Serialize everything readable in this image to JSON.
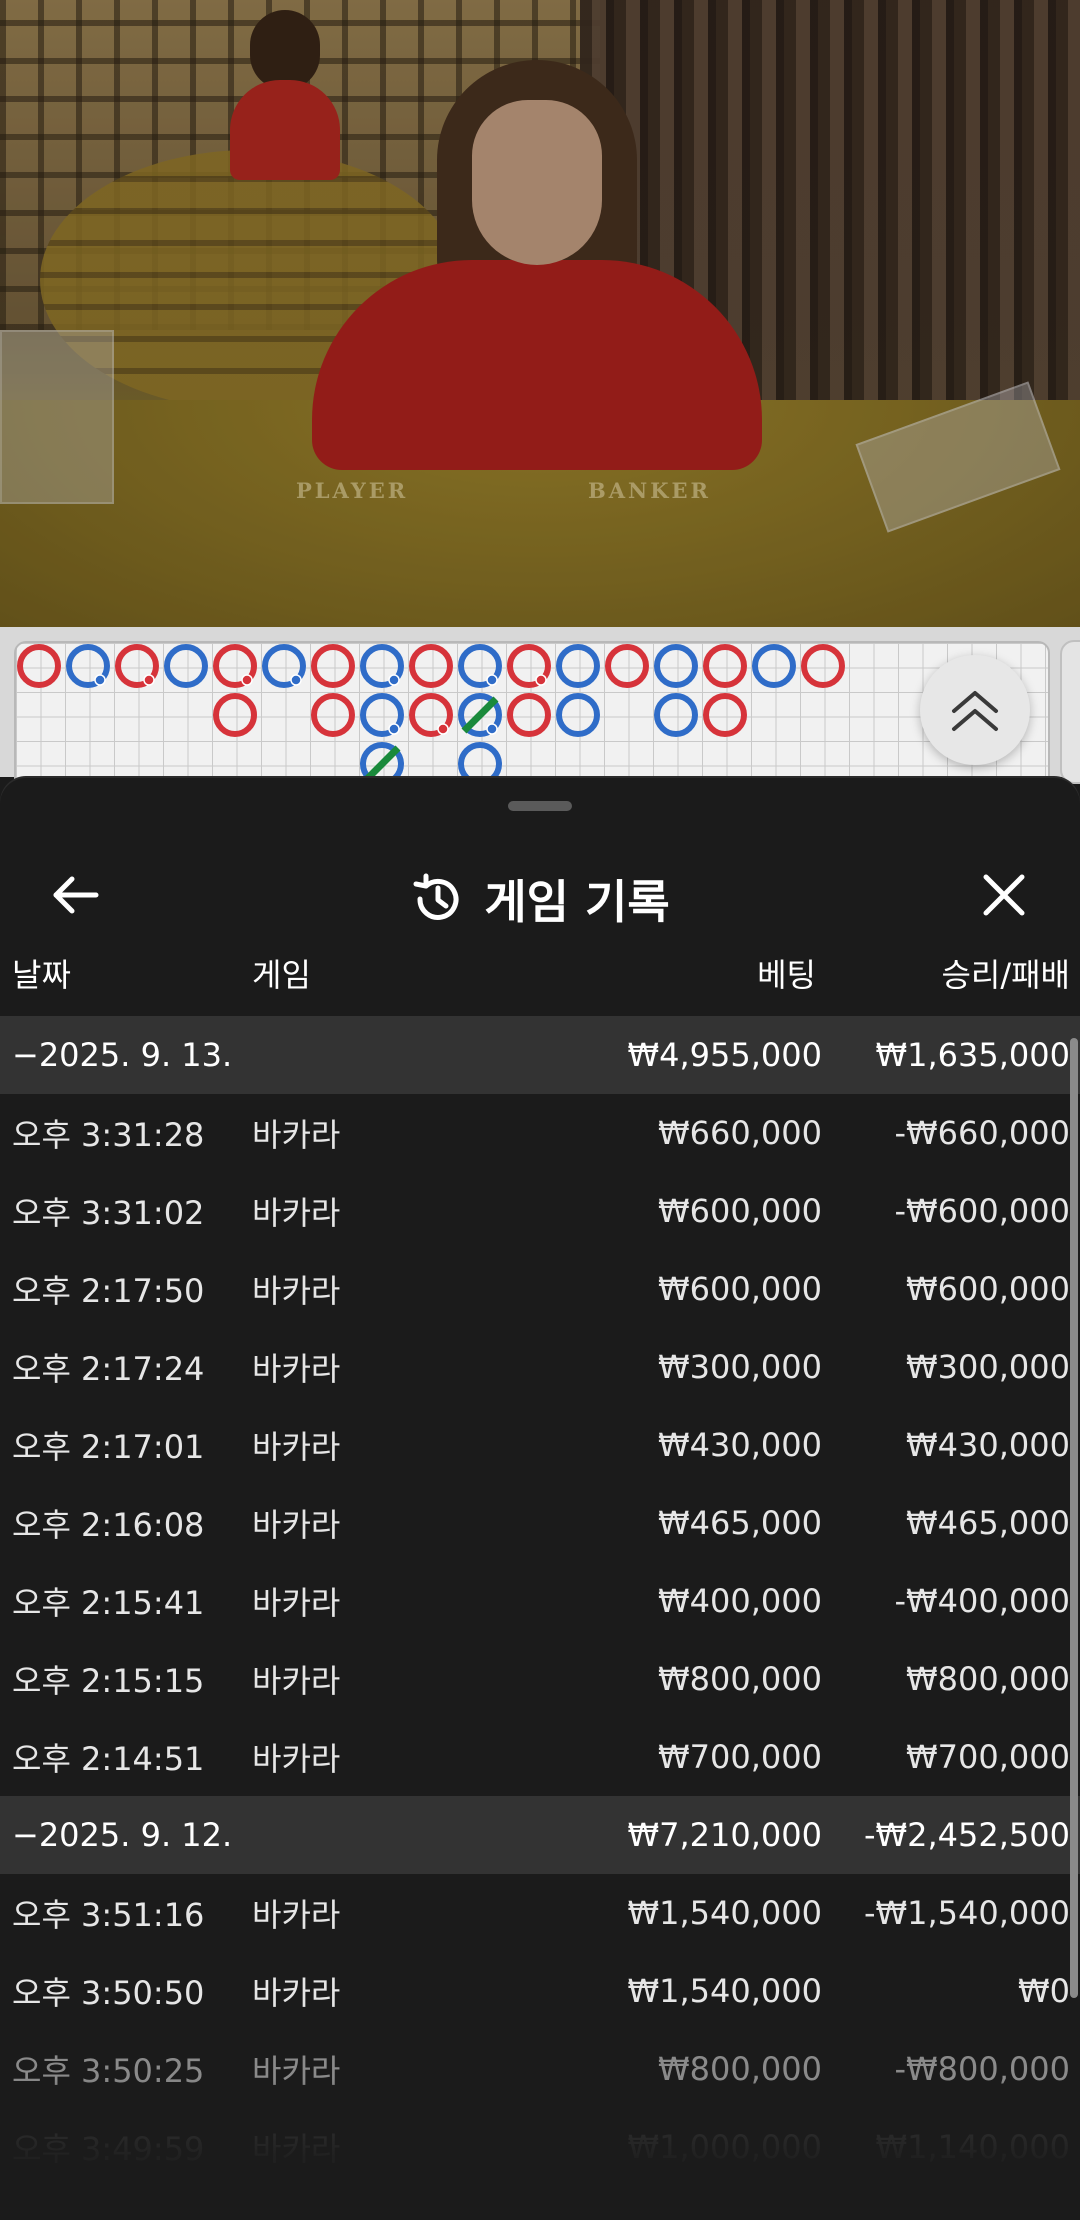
{
  "video": {
    "felt_player": "PLAYER",
    "felt_banker": "BANKER"
  },
  "bead_road": {
    "colors": {
      "banker": "#d6333a",
      "player": "#2f6cc8",
      "tie": "#1a8a3b"
    },
    "columns": [
      [
        "banker"
      ],
      [
        "player-pair"
      ],
      [
        "banker-pair"
      ],
      [
        "player"
      ],
      [
        "banker-pair",
        "banker"
      ],
      [
        "player-pair"
      ],
      [
        "banker",
        "banker"
      ],
      [
        "player-pair",
        "player-pair",
        "tie"
      ],
      [
        "banker",
        "banker-pair"
      ],
      [
        "player-pair",
        "tie-pair",
        "player"
      ],
      [
        "banker-pair",
        "banker"
      ],
      [
        "player",
        "player"
      ],
      [
        "banker"
      ],
      [
        "player",
        "player"
      ],
      [
        "banker",
        "banker"
      ],
      [
        "player"
      ],
      [
        "banker"
      ]
    ]
  },
  "header": {
    "title": "게임 기록",
    "back_icon": "arrow-left-icon",
    "history_icon": "history-icon",
    "close_icon": "close-icon"
  },
  "columns": {
    "date": "날짜",
    "game": "게임",
    "bet": "베팅",
    "result": "승리/패배"
  },
  "groups": [
    {
      "date": "−2025. 9. 13.",
      "bet_total": "₩4,955,000",
      "result_total": "₩1,635,000",
      "rows": [
        {
          "time": "오후 3:31:28",
          "game": "바카라",
          "bet": "₩660,000",
          "result": "-₩660,000"
        },
        {
          "time": "오후 3:31:02",
          "game": "바카라",
          "bet": "₩600,000",
          "result": "-₩600,000"
        },
        {
          "time": "오후 2:17:50",
          "game": "바카라",
          "bet": "₩600,000",
          "result": "₩600,000"
        },
        {
          "time": "오후 2:17:24",
          "game": "바카라",
          "bet": "₩300,000",
          "result": "₩300,000"
        },
        {
          "time": "오후 2:17:01",
          "game": "바카라",
          "bet": "₩430,000",
          "result": "₩430,000"
        },
        {
          "time": "오후 2:16:08",
          "game": "바카라",
          "bet": "₩465,000",
          "result": "₩465,000"
        },
        {
          "time": "오후 2:15:41",
          "game": "바카라",
          "bet": "₩400,000",
          "result": "-₩400,000"
        },
        {
          "time": "오후 2:15:15",
          "game": "바카라",
          "bet": "₩800,000",
          "result": "₩800,000"
        },
        {
          "time": "오후 2:14:51",
          "game": "바카라",
          "bet": "₩700,000",
          "result": "₩700,000"
        }
      ]
    },
    {
      "date": "−2025. 9. 12.",
      "bet_total": "₩7,210,000",
      "result_total": "-₩2,452,500",
      "rows": [
        {
          "time": "오후 3:51:16",
          "game": "바카라",
          "bet": "₩1,540,000",
          "result": "-₩1,540,000"
        },
        {
          "time": "오후 3:50:50",
          "game": "바카라",
          "bet": "₩1,540,000",
          "result": "₩0"
        },
        {
          "time": "오후 3:50:25",
          "game": "바카라",
          "bet": "₩800,000",
          "result": "-₩800,000"
        },
        {
          "time": "오후 3:49:59",
          "game": "바카라",
          "bet": "₩1,000,000",
          "result": "₩1,140,000"
        }
      ]
    }
  ]
}
